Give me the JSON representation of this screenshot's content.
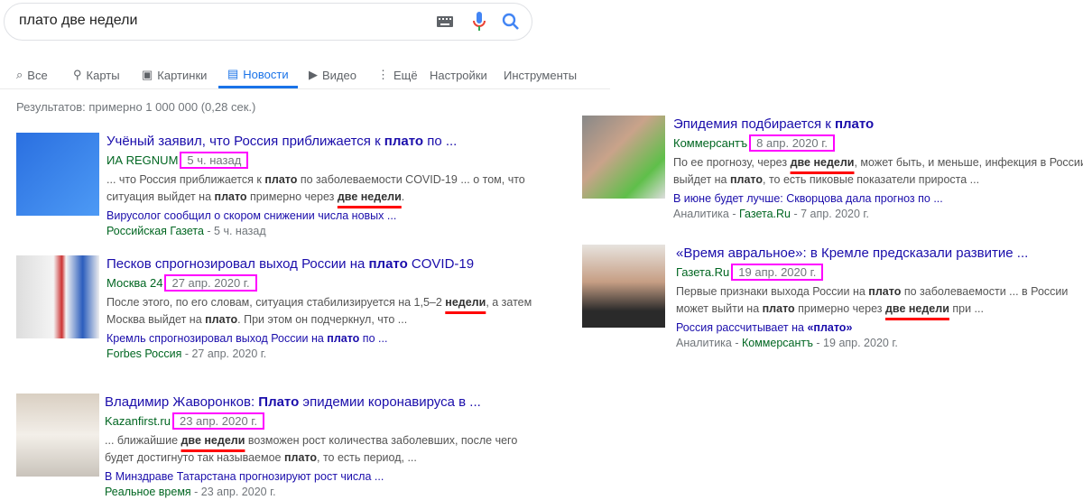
{
  "search": {
    "query": "плато две недели"
  },
  "tabs": [
    {
      "label": "Все",
      "icon": "search-icon"
    },
    {
      "label": "Карты",
      "icon": "pin-icon"
    },
    {
      "label": "Картинки",
      "icon": "image-icon"
    },
    {
      "label": "Новости",
      "icon": "news-icon",
      "active": true
    },
    {
      "label": "Видео",
      "icon": "play-icon"
    },
    {
      "label": "Ещё",
      "icon": "more-icon"
    },
    {
      "label": "Настройки"
    },
    {
      "label": "Инструменты"
    }
  ],
  "stats": "Результатов: примерно 1 000 000 (0,28 сек.)",
  "colors": {
    "link": "#1a0dab",
    "source": "#006621",
    "highlight_box": "#ff00ff",
    "underline": "#ff0000"
  },
  "results": [
    {
      "title": [
        {
          "t": "Учёный заявил, что Россия приближается к "
        },
        {
          "t": "плато",
          "b": 1
        },
        {
          "t": " по ..."
        }
      ],
      "source": "ИА REGNUM",
      "date": "5 ч. назад",
      "snippet": [
        [
          {
            "t": "... что Россия приближается к "
          },
          {
            "t": "плато",
            "b": 1
          },
          {
            "t": " по заболеваемости COVID-19 ... о том, что"
          }
        ],
        [
          {
            "t": "ситуация выйдет на "
          },
          {
            "t": "плато",
            "b": 1
          },
          {
            "t": " примерно через "
          },
          {
            "t": "две недели",
            "b": 1,
            "hl": 1
          },
          {
            "t": "."
          }
        ]
      ],
      "sub_title": [
        {
          "t": "Вирусолог сообщил о скором снижении числа новых ..."
        }
      ],
      "sub_source": [
        {
          "t": "Российская Газета",
          "g": 1
        },
        {
          "t": " - 5 ч. назад"
        }
      ]
    },
    {
      "title": [
        {
          "t": "Песков спрогнозировал выход России на "
        },
        {
          "t": "плато",
          "b": 1
        },
        {
          "t": " COVID-19"
        }
      ],
      "source": "Москва 24",
      "date": "27 апр. 2020 г.",
      "snippet": [
        [
          {
            "t": "После этого, по его словам, ситуация стабилизируется на 1,5–2 "
          },
          {
            "t": "недели",
            "b": 1,
            "hl": 1
          },
          {
            "t": ", а затем"
          }
        ],
        [
          {
            "t": "Москва выйдет на "
          },
          {
            "t": "плато",
            "b": 1
          },
          {
            "t": ". При этом он подчеркнул, что ..."
          }
        ]
      ],
      "sub_title": [
        {
          "t": "Кремль спрогнозировал выход России на "
        },
        {
          "t": "плато",
          "b": 1
        },
        {
          "t": " по ..."
        }
      ],
      "sub_source": [
        {
          "t": "Forbes Россия",
          "g": 1
        },
        {
          "t": " - 27 апр. 2020 г."
        }
      ]
    },
    {
      "title": [
        {
          "t": "Владимир Жаворонков: "
        },
        {
          "t": "Плато",
          "b": 1
        },
        {
          "t": " эпидемии коронавируса в ..."
        }
      ],
      "source": "Kazanfirst.ru",
      "date": "23 апр. 2020 г.",
      "snippet": [
        [
          {
            "t": "... ближайшие "
          },
          {
            "t": "две недели",
            "b": 1,
            "hl": 1
          },
          {
            "t": " возможен рост количества заболевших, после чего"
          }
        ],
        [
          {
            "t": "будет достигнуто так называемое "
          },
          {
            "t": "плато",
            "b": 1
          },
          {
            "t": ", то есть период, ..."
          }
        ]
      ],
      "sub_title": [
        {
          "t": "В Минздраве Татарстана прогнозируют рост числа ..."
        }
      ],
      "sub_source": [
        {
          "t": "Реальное время",
          "g": 1
        },
        {
          "t": " - 23 апр. 2020 г."
        }
      ]
    },
    {
      "title": [
        {
          "t": "Эпидемия подбирается к "
        },
        {
          "t": "плато",
          "b": 1
        }
      ],
      "source": "Коммерсантъ",
      "date": "8 апр. 2020 г.",
      "snippet": [
        [
          {
            "t": "По ее прогнозу, через "
          },
          {
            "t": "две недели",
            "b": 1,
            "hl": 1
          },
          {
            "t": ", может быть, и меньше, инфекция в России"
          }
        ],
        [
          {
            "t": "выйдет на "
          },
          {
            "t": "плато",
            "b": 1
          },
          {
            "t": ", то есть пиковые показатели прироста ..."
          }
        ]
      ],
      "sub_title": [
        {
          "t": "В июне будет лучше: Скворцова дала прогноз по ..."
        }
      ],
      "sub_source": [
        {
          "t": "Аналитика - "
        },
        {
          "t": "Газета.Ru",
          "g": 1
        },
        {
          "t": " - 7 апр. 2020 г."
        }
      ]
    },
    {
      "title": [
        {
          "t": "«Время авральное»: в Кремле предсказали развитие ..."
        }
      ],
      "source": "Газета.Ru",
      "date": "19 апр. 2020 г.",
      "snippet": [
        [
          {
            "t": "Первые признаки выхода России на "
          },
          {
            "t": "плато",
            "b": 1
          },
          {
            "t": " по заболеваемости ... в России"
          }
        ],
        [
          {
            "t": "может выйти на "
          },
          {
            "t": "плато",
            "b": 1
          },
          {
            "t": " примерно через "
          },
          {
            "t": "две недели",
            "b": 1,
            "hl": 1
          },
          {
            "t": " при ..."
          }
        ]
      ],
      "sub_title": [
        {
          "t": "Россия рассчитывает на "
        },
        {
          "t": "«плато»",
          "b": 1
        }
      ],
      "sub_source": [
        {
          "t": "Аналитика - "
        },
        {
          "t": "Коммерсантъ",
          "g": 1
        },
        {
          "t": " - 19 апр. 2020 г."
        }
      ]
    }
  ]
}
